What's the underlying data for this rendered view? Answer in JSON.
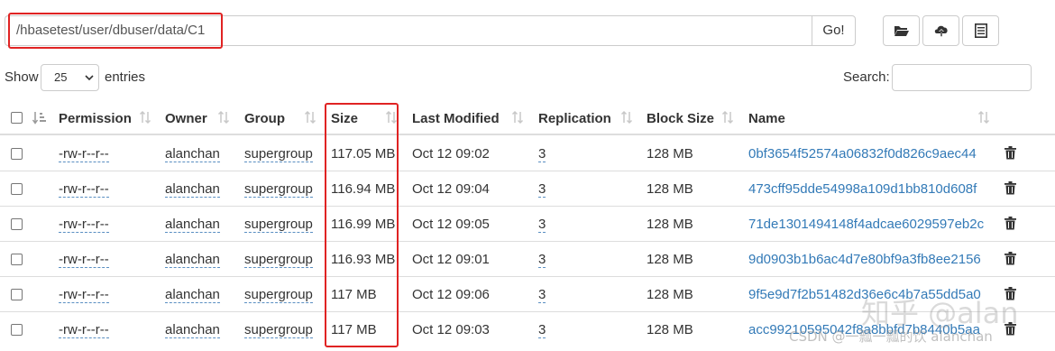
{
  "pathbar": {
    "path": "/hbasetest/user/dbuser/data/C1",
    "go_label": "Go!",
    "buttons": [
      {
        "icon": "folder-open-icon"
      },
      {
        "icon": "cloud-upload-icon"
      },
      {
        "icon": "list-icon"
      }
    ]
  },
  "controls": {
    "show_label": "Show",
    "page_size": "25",
    "entries_label": "entries",
    "search_label": "Search:"
  },
  "table": {
    "columns": [
      "Permission",
      "Owner",
      "Group",
      "Size",
      "Last Modified",
      "Replication",
      "Block Size",
      "Name"
    ],
    "rows": [
      {
        "permission": "-rw-r--r--",
        "owner": "alanchan",
        "group": "supergroup",
        "size": "117.05 MB",
        "modified": "Oct 12 09:02",
        "replication": "3",
        "block_size": "128 MB",
        "name": "0bf3654f52574a06832f0d826c9aec44"
      },
      {
        "permission": "-rw-r--r--",
        "owner": "alanchan",
        "group": "supergroup",
        "size": "116.94 MB",
        "modified": "Oct 12 09:04",
        "replication": "3",
        "block_size": "128 MB",
        "name": "473cff95dde54998a109d1bb810d608f"
      },
      {
        "permission": "-rw-r--r--",
        "owner": "alanchan",
        "group": "supergroup",
        "size": "116.99 MB",
        "modified": "Oct 12 09:05",
        "replication": "3",
        "block_size": "128 MB",
        "name": "71de1301494148f4adcae6029597eb2c"
      },
      {
        "permission": "-rw-r--r--",
        "owner": "alanchan",
        "group": "supergroup",
        "size": "116.93 MB",
        "modified": "Oct 12 09:01",
        "replication": "3",
        "block_size": "128 MB",
        "name": "9d0903b1b6ac4d7e80bf9a3fb8ee2156"
      },
      {
        "permission": "-rw-r--r--",
        "owner": "alanchan",
        "group": "supergroup",
        "size": "117 MB",
        "modified": "Oct 12 09:06",
        "replication": "3",
        "block_size": "128 MB",
        "name": "9f5e9d7f2b51482d36e6c4b7a55dd5a0"
      },
      {
        "permission": "-rw-r--r--",
        "owner": "alanchan",
        "group": "supergroup",
        "size": "117 MB",
        "modified": "Oct 12 09:03",
        "replication": "3",
        "block_size": "128 MB",
        "name": "acc99210595042f8a8bbfd7b8440b5aa"
      }
    ]
  },
  "watermark": {
    "main": "知乎 @alan",
    "sub": "CSDN @一瓢一瓢的饮 alanchan"
  },
  "colors": {
    "highlight": "#e02323",
    "link": "#337ab7",
    "border": "#dddddd"
  }
}
